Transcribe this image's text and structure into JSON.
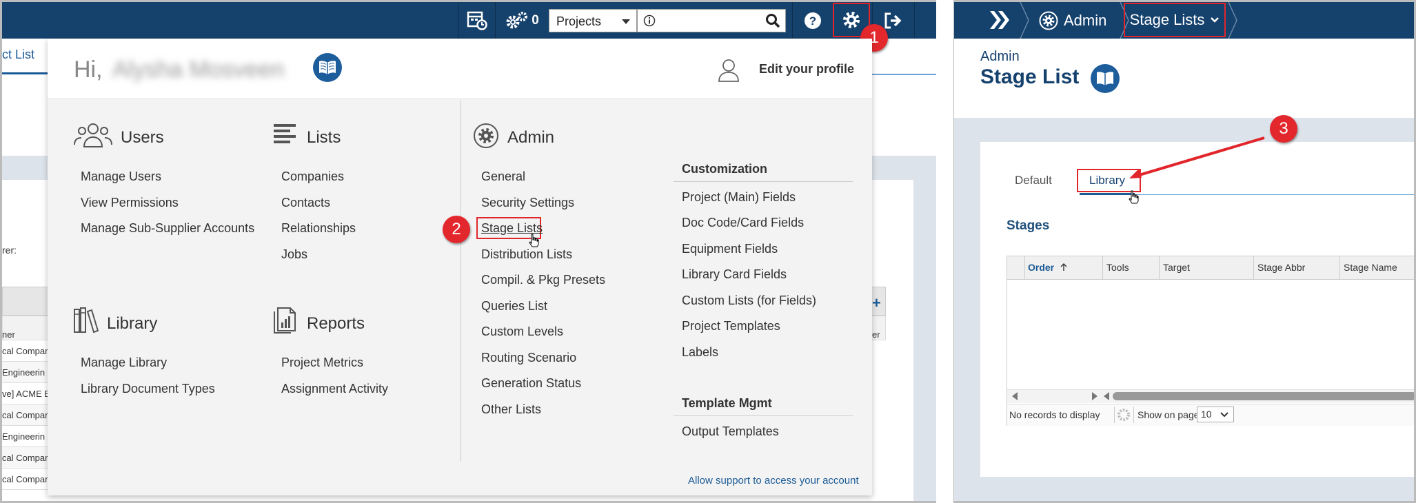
{
  "left": {
    "topbar": {
      "gear_count": "0",
      "project_select": "Projects"
    },
    "behind": {
      "tab_fragment": "ct List",
      "label_fragment": "rer:",
      "col_fragment": "ner",
      "col_fragment_right": "er",
      "rows": [
        "cal Compar",
        "Engineerin",
        "ve] ACME E",
        "cal Compar",
        "Engineerin",
        "cal Compar",
        "cal Compar"
      ]
    },
    "menu": {
      "greeting": "Hi,",
      "user_name": "Alysha Mosveen",
      "edit_profile": "Edit your profile",
      "users": {
        "title": "Users",
        "items": [
          "Manage Users",
          "View Permissions",
          "Manage Sub-Supplier Accounts"
        ]
      },
      "lists": {
        "title": "Lists",
        "items": [
          "Companies",
          "Contacts",
          "Relationships",
          "Jobs"
        ]
      },
      "library": {
        "title": "Library",
        "items": [
          "Manage Library",
          "Library Document Types"
        ]
      },
      "reports": {
        "title": "Reports",
        "items": [
          "Project Metrics",
          "Assignment Activity"
        ]
      },
      "admin": {
        "title": "Admin",
        "items": [
          "General",
          "Security Settings",
          "Stage Lists",
          "Distribution Lists",
          "Compil. & Pkg Presets",
          "Queries List",
          "Custom Levels",
          "Routing Scenario",
          "Generation Status",
          "Other Lists"
        ]
      },
      "customization": {
        "title": "Customization",
        "items": [
          "Project (Main) Fields",
          "Doc Code/Card Fields",
          "Equipment Fields",
          "Library Card Fields",
          "Custom Lists (for Fields)",
          "Project Templates",
          "Labels"
        ]
      },
      "template_mgmt": {
        "title": "Template Mgmt",
        "items": [
          "Output Templates"
        ]
      },
      "support_link": "Allow support to access your account"
    },
    "steps": [
      "1",
      "2"
    ]
  },
  "right": {
    "breadcrumb": {
      "admin": "Admin",
      "current": "Stage Lists"
    },
    "header": {
      "section": "Admin",
      "title": "Stage List"
    },
    "tabs": [
      "Default",
      "Library"
    ],
    "stages_label": "Stages",
    "grid": {
      "columns": [
        "Order",
        "Tools",
        "Target",
        "Stage Abbr",
        "Stage Name"
      ],
      "no_records": "No records to display",
      "show_on_page": "Show on page:",
      "page_size": "10"
    },
    "step": "3"
  },
  "colors": {
    "navy": "#15416d",
    "link_blue": "#1a5a96",
    "highlight_red": "#e0262b"
  }
}
